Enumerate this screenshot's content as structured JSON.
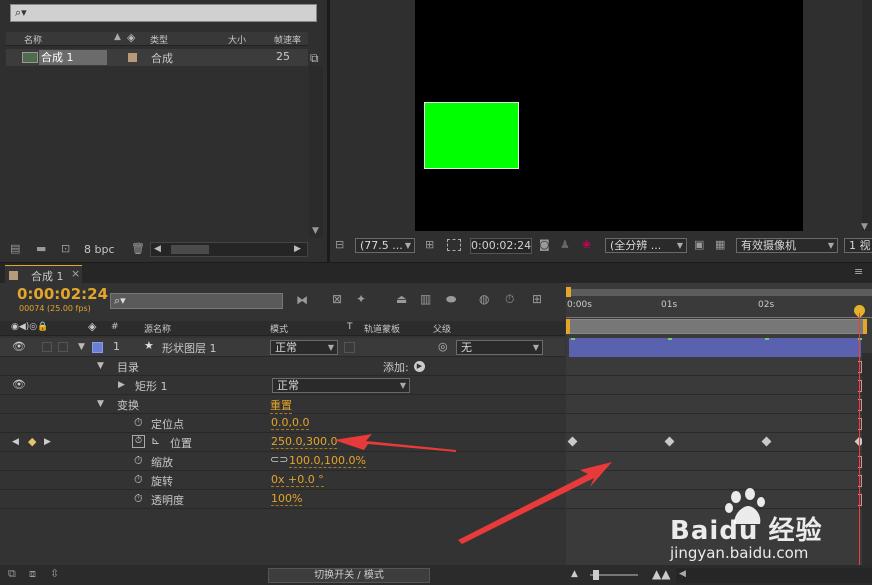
{
  "project": {
    "search_placeholder": "⌕▾",
    "columns": {
      "name": "名称",
      "type": "类型",
      "size": "大小",
      "fps": "帧速率"
    },
    "items": [
      {
        "name": "合成 1",
        "type": "合成",
        "fps": "25"
      }
    ],
    "bpc": "8 bpc"
  },
  "viewer": {
    "zoom": "(77.5 ...",
    "timecode": "0:00:02:24",
    "resolution": "(全分辨 ...",
    "camera": "有效摄像机",
    "views": "1 视"
  },
  "timeline": {
    "tab_label": "合成 1",
    "current_time": "0:00:02:24",
    "frame_info": "00074 (25.00 fps)",
    "headers": {
      "num": "#",
      "source": "源名称",
      "mode": "模式",
      "t": "T",
      "trkmat": "轨道蒙板",
      "parent": "父级"
    },
    "layer": {
      "index": "1",
      "name": "形状图层 1",
      "mode": "正常",
      "parent": "无"
    },
    "contents_label": "目录",
    "add_label": "添加:",
    "rect_label": "矩形 1",
    "rect_mode": "正常",
    "transform_label": "变换",
    "reset_label": "重置",
    "props": [
      {
        "name": "定位点",
        "value": "0.0,0.0"
      },
      {
        "name": "位置",
        "value": "250.0,300.0"
      },
      {
        "name": "缩放",
        "value": "100.0,100.0%"
      },
      {
        "name": "旋转",
        "value": "0x +0.0 °"
      },
      {
        "name": "透明度",
        "value": "100%"
      }
    ],
    "ruler": [
      "0:00s",
      "01s",
      "02s"
    ],
    "toggle_label": "切换开关 / 模式"
  },
  "watermark": {
    "brand": "Baidu 经验",
    "url": "jingyan.baidu.com"
  },
  "colors": {
    "accent": "#e3a52a",
    "label_blue": "#6c7fd6",
    "layer_bar": "#5a62b0",
    "shape_green": "#00ff00",
    "arrow_red": "#e83a3a"
  }
}
